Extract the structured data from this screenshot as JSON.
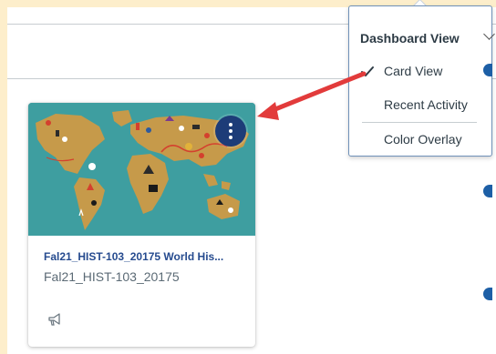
{
  "card": {
    "title": "Fal21_HIST-103_20175 World His...",
    "subtitle": "Fal21_HIST-103_20175"
  },
  "menu": {
    "heading": "Dashboard View",
    "items": [
      {
        "label": "Card View",
        "selected": true
      },
      {
        "label": "Recent Activity",
        "selected": false
      },
      {
        "label": "Color Overlay",
        "selected": false
      }
    ]
  },
  "colors": {
    "page_border": "#fdeecb",
    "card_hero": "#3e9ea0",
    "kebab": "#1d3c78",
    "card_title": "#264b8f",
    "arrow": "#e23b3b"
  },
  "icons": {
    "kebab": "options-kebab-icon",
    "announcement": "megaphone-icon",
    "check": "checkmark-icon"
  }
}
